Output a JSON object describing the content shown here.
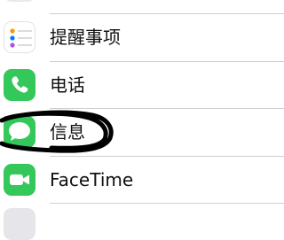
{
  "settings_list": {
    "items": [
      {
        "label": "提醒事项",
        "icon": "reminders-icon"
      },
      {
        "label": "电话",
        "icon": "phone-icon"
      },
      {
        "label": "信息",
        "icon": "messages-icon"
      },
      {
        "label": "FaceTime",
        "icon": "facetime-icon"
      }
    ]
  },
  "colors": {
    "reminders_bg": "#ffffff",
    "phone_green": "#34c759",
    "messages_green": "#34c759",
    "facetime_green": "#34c759",
    "annotation_ink": "#000000"
  }
}
